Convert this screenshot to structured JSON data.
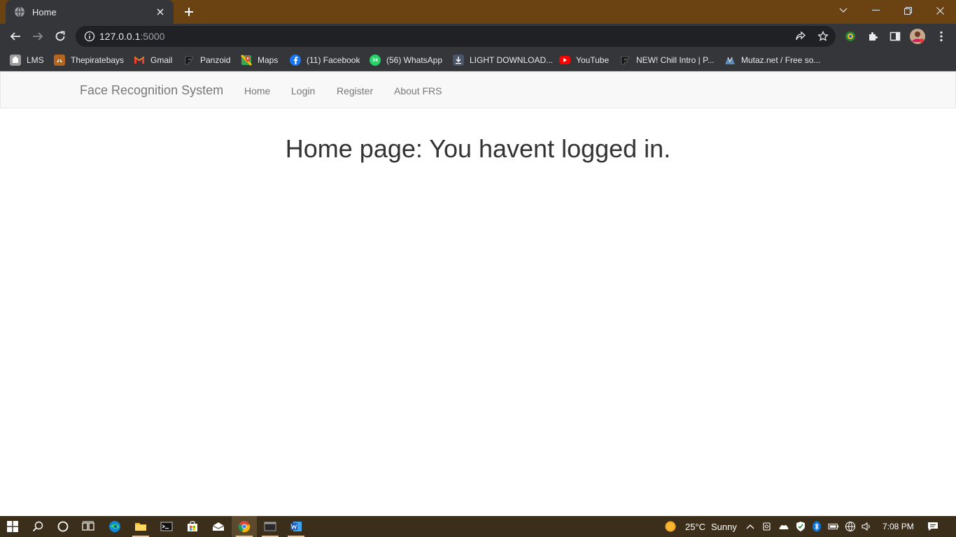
{
  "browser": {
    "tab": {
      "title": "Home"
    },
    "url": {
      "host": "127.0.0.1",
      "port": ":5000"
    },
    "bookmarks": [
      {
        "label": "LMS",
        "icon": "lms-icon",
        "color": "#9e9e9e"
      },
      {
        "label": "Thepiratebays",
        "icon": "pirate-icon",
        "color": "#b5651d"
      },
      {
        "label": "Gmail",
        "icon": "gmail-icon",
        "color": "#ea4335"
      },
      {
        "label": "Panzoid",
        "icon": "panzoid-icon",
        "color": "#111111"
      },
      {
        "label": "Maps",
        "icon": "maps-icon",
        "color": "#34a853"
      },
      {
        "label": "(11) Facebook",
        "icon": "facebook-icon",
        "color": "#1877f2"
      },
      {
        "label": "(56) WhatsApp",
        "icon": "whatsapp-icon",
        "color": "#25d366"
      },
      {
        "label": "LIGHT DOWNLOAD...",
        "icon": "download-icon",
        "color": "#4a5568"
      },
      {
        "label": "YouTube",
        "icon": "youtube-icon",
        "color": "#ff0000"
      },
      {
        "label": "NEW! Chill Intro | P...",
        "icon": "panzoid-icon",
        "color": "#111111"
      },
      {
        "label": "Mutaz.net / Free so...",
        "icon": "mutaz-icon",
        "color": "#5b8db8"
      }
    ],
    "whatsapp_badge": "34"
  },
  "page": {
    "brand": "Face Recognition System",
    "nav": [
      "Home",
      "Login",
      "Register",
      "About FRS"
    ],
    "heading": "Home page: You havent logged in."
  },
  "taskbar": {
    "weather": {
      "temp": "25°C",
      "condition": "Sunny"
    },
    "time": "7:08 PM"
  },
  "colors": {
    "titlebar": "#6b4312",
    "toolbar": "#35363a",
    "taskbar": "#3b2f1c",
    "navbar_bg": "#f8f8f8"
  }
}
